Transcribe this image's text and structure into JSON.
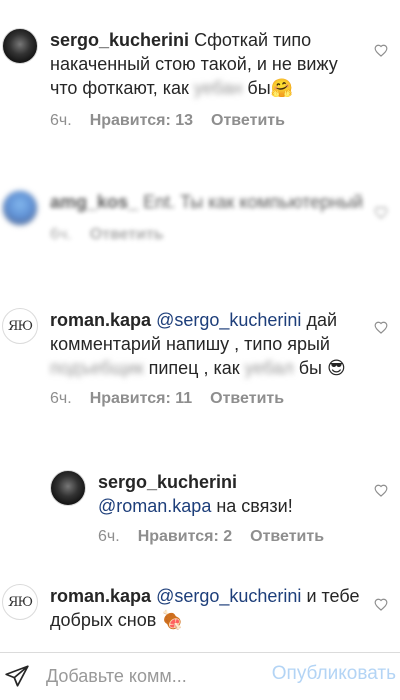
{
  "comments": [
    {
      "username": "sergo_kucherini",
      "text_1": "Сфоткай типо накаченный стою такой, и не вижу что фоткают, как",
      "censored": "уебан",
      "text_2": "бы",
      "emoji": "🤗",
      "time": "6ч.",
      "likes": "Нравится: 13",
      "reply": "Ответить"
    },
    {
      "username": "amg_kos_",
      "text_1": "Ent. Ты как компьютерный",
      "time": "6ч.",
      "reply": "Ответить"
    },
    {
      "username": "roman.kapa",
      "mention": "@sergo_kucherini",
      "text_1": "дай комментарий напишу , типо ярый",
      "censored_1": "подъебщик",
      "text_2": "пипец , как",
      "censored_2": "уебал",
      "text_3": "бы",
      "emoji": "😎",
      "time": "6ч.",
      "likes": "Нравится: 11",
      "reply": "Ответить"
    },
    {
      "username": "sergo_kucherini",
      "mention": "@roman.kapa",
      "text_1": "на связи!",
      "time": "6ч.",
      "likes": "Нравится: 2",
      "reply": "Ответить"
    },
    {
      "username": "roman.kapa",
      "mention": "@sergo_kucherini",
      "text_1": "и тебе добрых снов",
      "emoji": "🍖"
    }
  ],
  "footer": {
    "placeholder": "Добавьте комм...",
    "publish_label": "Опубликовать"
  },
  "colors": {
    "mention": "#1d3e7a",
    "meta": "#8e8e8e",
    "publish_disabled": "#b3d4f5"
  },
  "icons": [
    "heart-outline-icon",
    "send-icon"
  ]
}
